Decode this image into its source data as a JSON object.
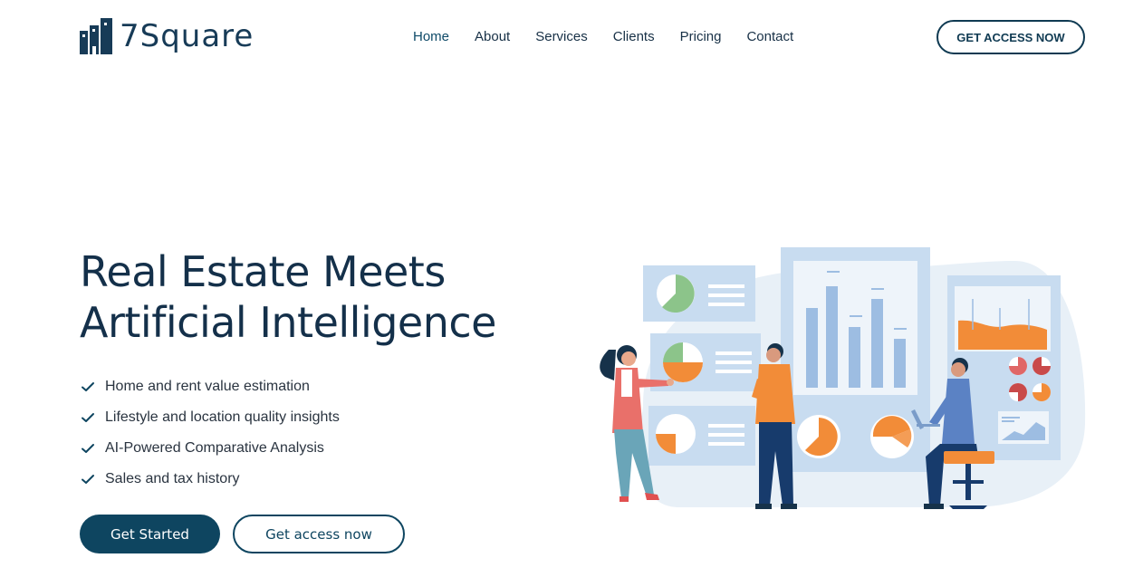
{
  "brand": {
    "name": "7Square",
    "logo_icon": "building-bars-icon"
  },
  "nav": {
    "items": [
      "Home",
      "About",
      "Services",
      "Clients",
      "Pricing",
      "Contact"
    ],
    "active": "Home"
  },
  "header": {
    "cta_label": "GET ACCESS NOW"
  },
  "hero": {
    "title_line1": "Real Estate Meets",
    "title_line2": "Artificial Intelligence",
    "features": [
      "Home and rent value estimation",
      "Lifestyle and location quality insights",
      "AI-Powered Comparative Analysis",
      "Sales and tax history"
    ],
    "primary_button": "Get Started",
    "secondary_button": "Get access now",
    "illustration_icon": "data-analytics-illustration"
  },
  "colors": {
    "brand_dark": "#0e4560",
    "text_dark": "#14304a",
    "accent_orange": "#f28c38",
    "panel_blue": "#cfe0f2",
    "bar_blue": "#9dbde2"
  }
}
